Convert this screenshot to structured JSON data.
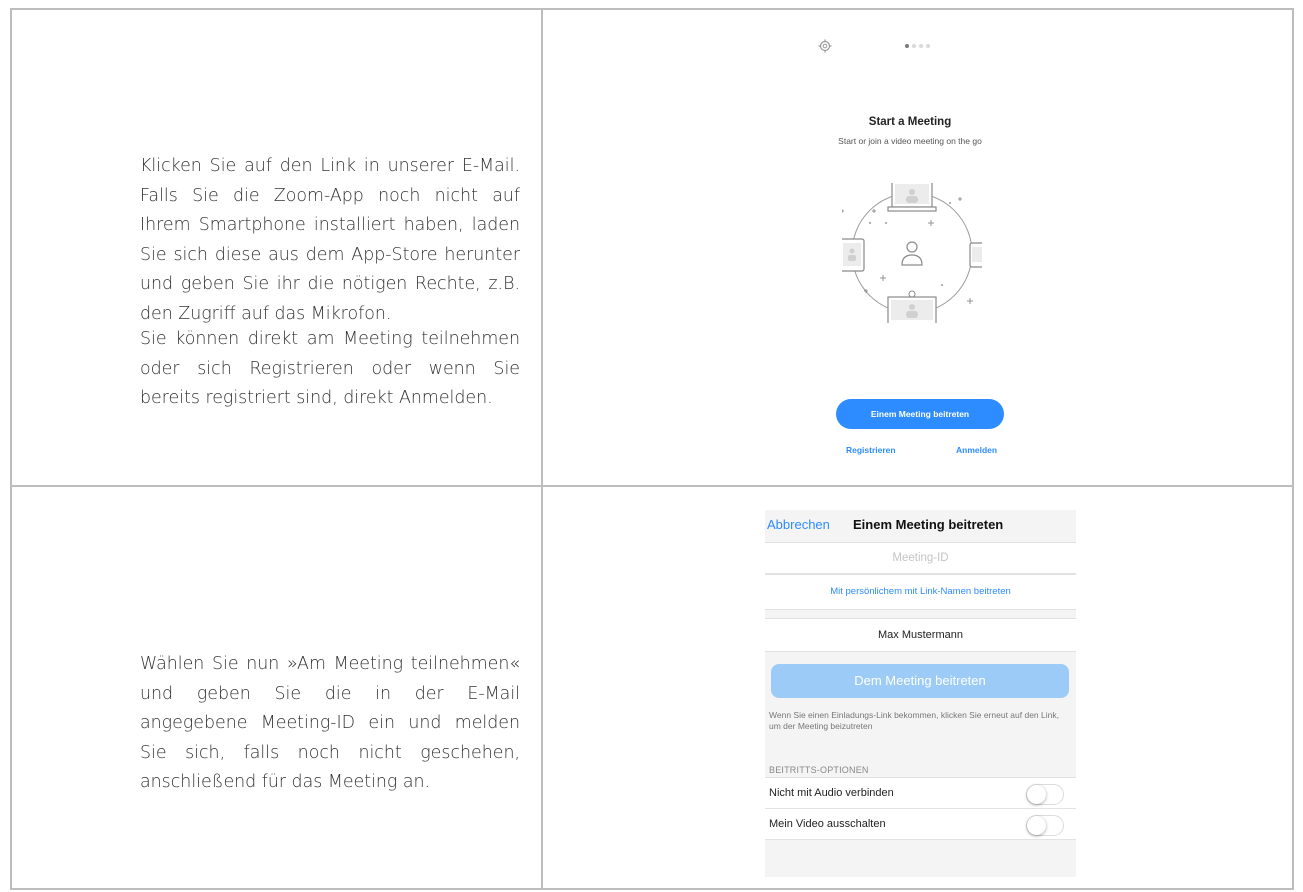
{
  "instructions": {
    "step1_p1": "Klicken Sie auf den Link in unserer E-Mail. Falls Sie die Zoom-App noch nicht auf Ihrem Smartphone installiert haben, laden Sie sich diese aus dem App-Store herunter und geben Sie ihr die nötigen Rechte, z.B. den Zugriff auf das Mikrofon.",
    "step1_p2": "Sie können direkt am Meeting teilnehmen oder sich Registrieren oder wenn Sie bereits registriert sind, direkt Anmelden.",
    "step2_p1": "Wählen Sie nun »Am Meeting teilnehmen« und geben Sie die in der E-Mail angegebene Meeting-ID ein und melden Sie sich, falls noch nicht geschehen, anschließend für das Meeting an."
  },
  "screen1": {
    "settings_icon": "gear-icon",
    "page_dots": 4,
    "active_dot": 1,
    "title": "Start a Meeting",
    "subtitle": "Start or join a video meeting on the go",
    "join_button": "Einem Meeting beitreten",
    "register_link": "Registrieren",
    "login_link": "Anmelden",
    "accent_color": "#2d8cff"
  },
  "screen2": {
    "cancel": "Abbrechen",
    "title": "Einem Meeting beitreten",
    "meeting_id_placeholder": "Meeting-ID",
    "link_name_option": "Mit persönlichem mit Link-Namen beitreten",
    "name_value": "Max Mustermann",
    "join_button": "Dem Meeting beitreten",
    "hint": "Wenn Sie einen Einladungs-Link bekommen, klicken Sie erneut auf den Link, um der Meeting beizutreten",
    "options_header": "BEITRITTS-OPTIONEN",
    "options": [
      {
        "label": "Nicht mit Audio verbinden",
        "enabled": false
      },
      {
        "label": "Mein Video ausschalten",
        "enabled": false
      }
    ]
  }
}
